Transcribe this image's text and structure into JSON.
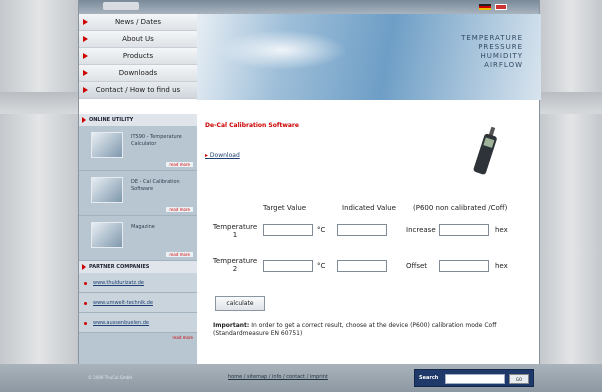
{
  "header": {
    "company": "",
    "hero_words": [
      "TEMPERATURE",
      "PRESSURE",
      "HUMIDITY",
      "AIRFLOW"
    ]
  },
  "nav": {
    "items": [
      "News / Dates",
      "About Us",
      "Products",
      "Downloads",
      "Contact / How to find us"
    ]
  },
  "sidebar": {
    "online_title": "ONLINE UTILITY",
    "products": [
      {
        "text": "ITS90 - Temperature Calculator",
        "more": "read more"
      },
      {
        "text": "DE - Cal Calibration Software",
        "more": "read more"
      },
      {
        "text": "Magazine",
        "more": "read more"
      }
    ],
    "partner_title": "PARTNER COMPANIES",
    "partners": [
      "www.thuldurizatz.de",
      "www.umwelt-technik.de",
      "www.aussenbuelen.de"
    ],
    "partner_more": "read more"
  },
  "main": {
    "title": "De-Cal Calibration Software",
    "download": "Download",
    "columns": [
      "Target Value",
      "Indicated Value",
      "(P600 non calibrated /Coff)"
    ],
    "rows": [
      {
        "label": "Temperature 1",
        "unit": "°C",
        "extra_label": "Increase",
        "extra_unit": "hex"
      },
      {
        "label": "Temperature 2",
        "unit": "°C",
        "extra_label": "Offset",
        "extra_unit": "hex"
      }
    ],
    "calculate": "calculate",
    "important_label": "Important:",
    "important_text": "In order to get a correct result, choose at the device (P600) calibration mode Coff (Standardmeasure EN 60751)"
  },
  "footer": {
    "copyright": "© 2009 ThuCal GmbH",
    "links": "home / sitemap / info / contact / imprint",
    "search_label": "Search",
    "search_button": "GO"
  }
}
